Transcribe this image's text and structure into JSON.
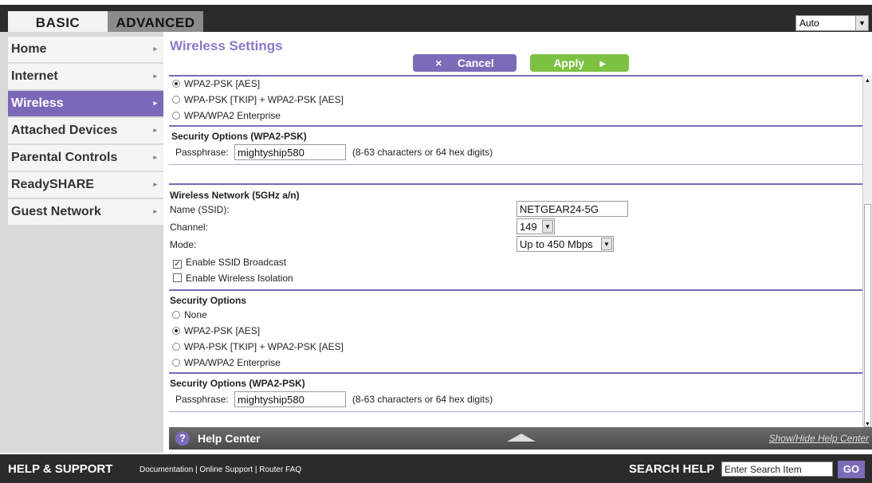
{
  "tabs": {
    "basic": "BASIC",
    "advanced": "ADVANCED"
  },
  "language": {
    "selected": "Auto",
    "arrow_icon": "chevron-down-icon"
  },
  "sidebar": {
    "items": [
      {
        "label": "Home"
      },
      {
        "label": "Internet"
      },
      {
        "label": "Wireless"
      },
      {
        "label": "Attached Devices"
      },
      {
        "label": "Parental Controls"
      },
      {
        "label": "ReadySHARE"
      },
      {
        "label": "Guest Network"
      }
    ],
    "active": "Wireless",
    "chevron": "▸"
  },
  "page": {
    "title": "Wireless Settings",
    "cancel_icon": "×",
    "cancel": "Cancel",
    "apply": "Apply",
    "apply_icon": "▸"
  },
  "security24": {
    "opt_wpa2": "WPA2-PSK [AES]",
    "opt_mixed": "WPA-PSK [TKIP] + WPA2-PSK [AES]",
    "opt_ent": "WPA/WPA2 Enterprise",
    "heading": "Security Options (WPA2-PSK)",
    "pass_label": "Passphrase:",
    "pass_value": "mightyship580",
    "pass_hint": "(8-63 characters or 64 hex digits)"
  },
  "wireless5": {
    "heading": "Wireless Network (5GHz a/n)",
    "ssid_label": "Name (SSID):",
    "ssid_value": "NETGEAR24-5G",
    "channel_label": "Channel:",
    "channel_value": "149",
    "mode_label": "Mode:",
    "mode_value": "Up to 450 Mbps",
    "broadcast_label": "Enable SSID Broadcast",
    "broadcast_checked": true,
    "isolation_label": "Enable Wireless Isolation",
    "isolation_checked": false
  },
  "security5": {
    "heading": "Security Options",
    "opt_none": "None",
    "opt_wpa2": "WPA2-PSK [AES]",
    "opt_mixed": "WPA-PSK [TKIP] + WPA2-PSK [AES]",
    "opt_ent": "WPA/WPA2 Enterprise",
    "heading2": "Security Options (WPA2-PSK)",
    "pass_label": "Passphrase:",
    "pass_value": "mightyship580",
    "pass_hint": "(8-63 characters or 64 hex digits)"
  },
  "help": {
    "icon": "?",
    "title": "Help Center",
    "toggle": "Show/Hide Help Center"
  },
  "footer": {
    "title": "HELP & SUPPORT",
    "link1": "Documentation",
    "link2": "Online Support",
    "link3": "Router FAQ",
    "search_label": "SEARCH HELP",
    "search_value": "Enter Search Item",
    "go": "GO"
  },
  "colors": {
    "accent": "#7b6bb8",
    "apply": "#7cc142",
    "topbar": "#2b2b2b"
  }
}
